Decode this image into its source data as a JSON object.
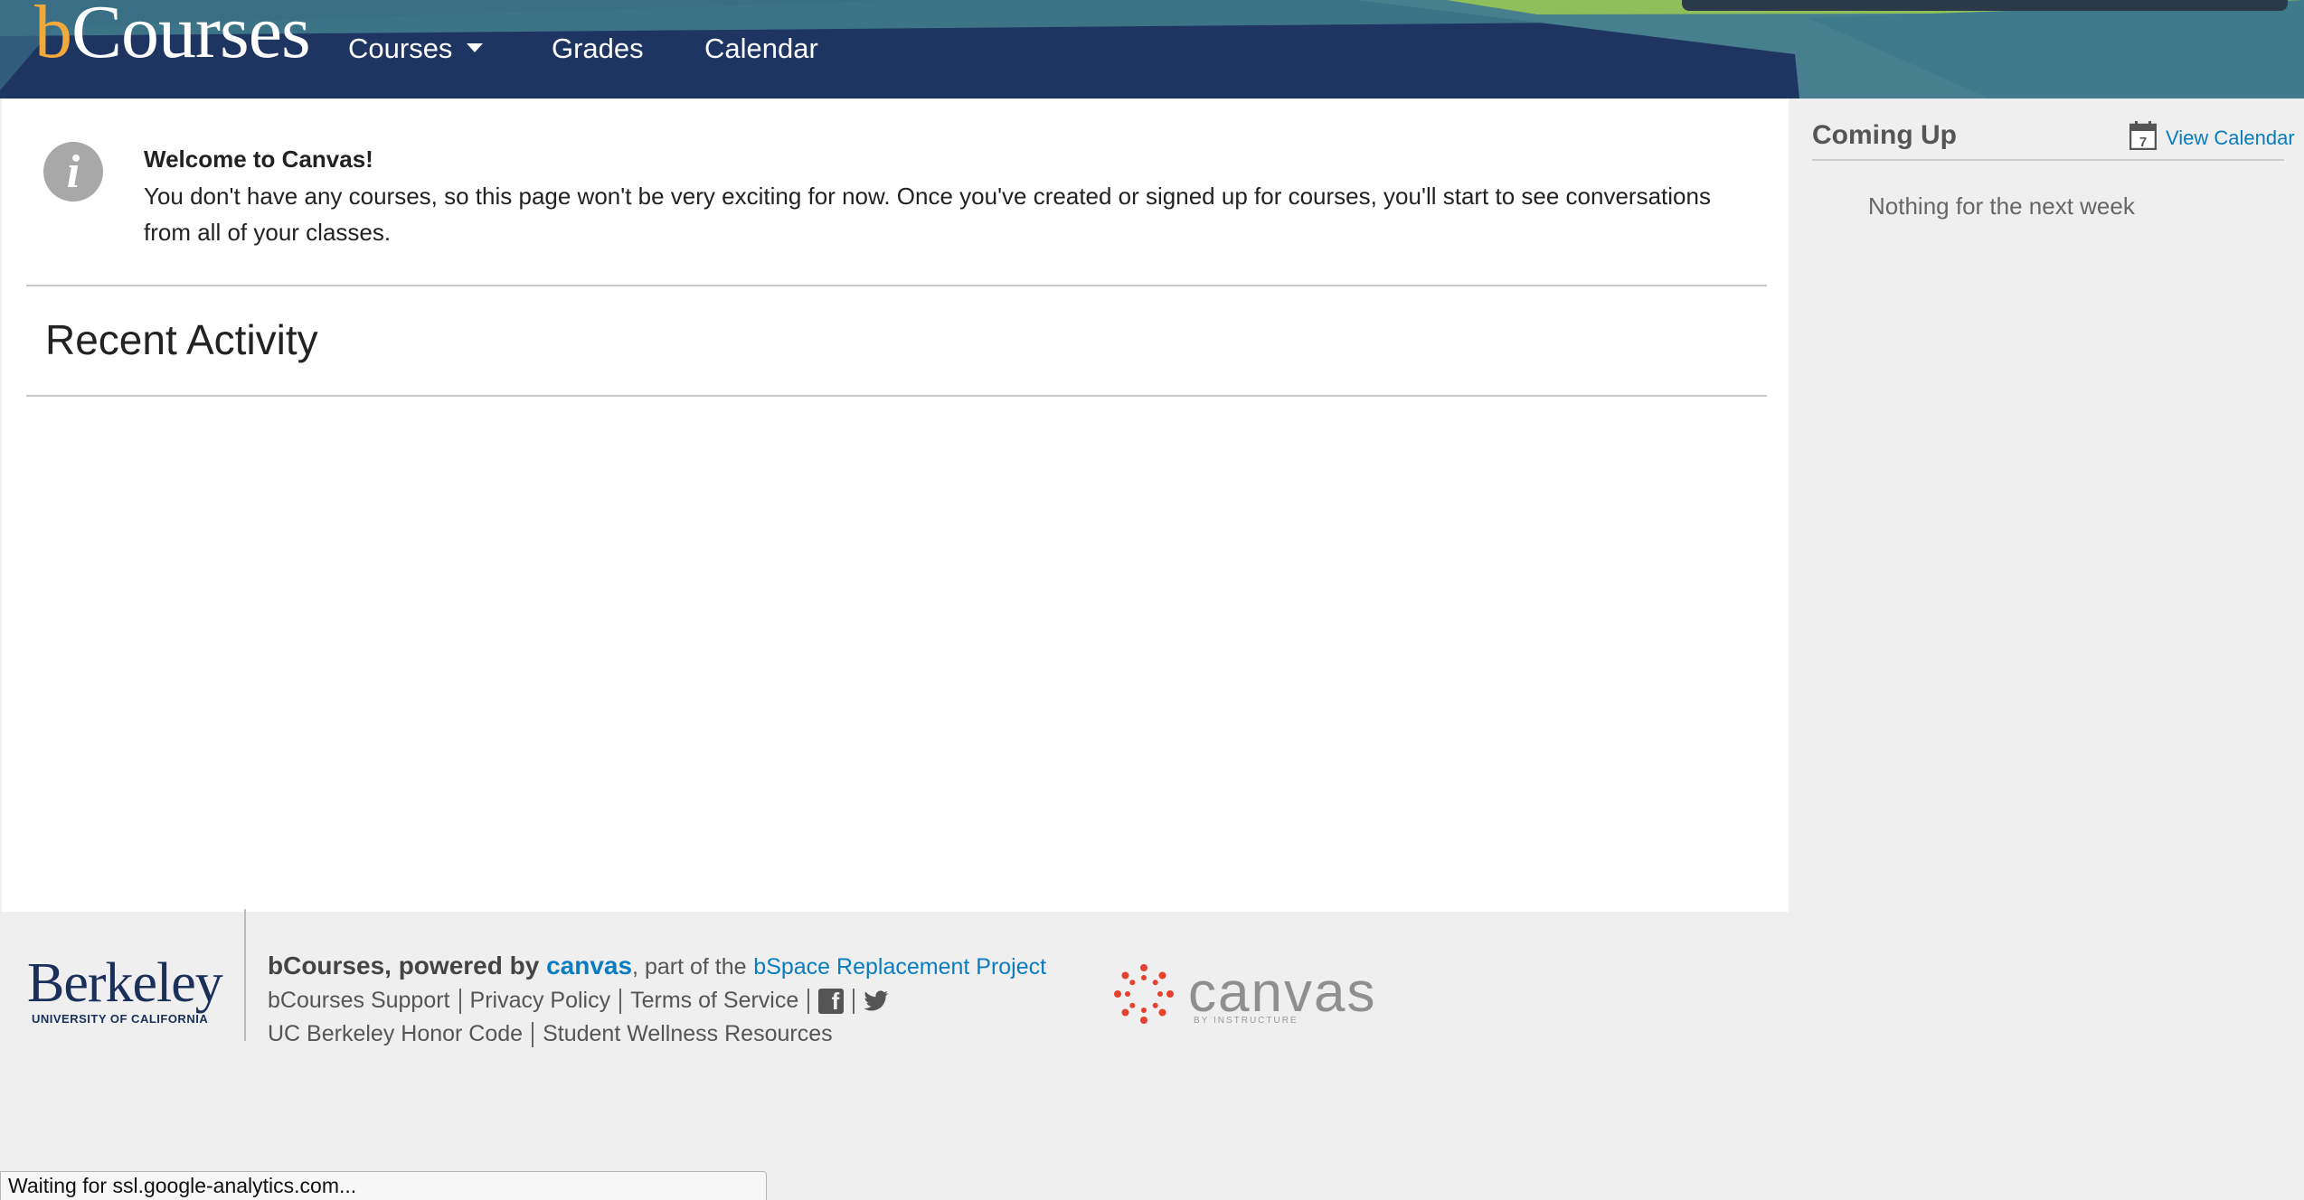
{
  "header": {
    "logo_letter": "b",
    "logo_rest": "Courses",
    "nav": [
      {
        "label": "Courses"
      },
      {
        "label": "Grades"
      },
      {
        "label": "Calendar"
      }
    ],
    "colors": {
      "navy": "#1e3461",
      "teal": "#3f7a8c",
      "green": "#8fbf5a",
      "gold": "#f2a93b"
    }
  },
  "welcome": {
    "title": "Welcome to Canvas!",
    "text": "You don't have any courses, so this page won't be very exciting for now. Once you've created or signed up for courses, you'll start to see conversations from all of your classes.",
    "icon_glyph": "i"
  },
  "recent_activity": {
    "title": "Recent Activity"
  },
  "sidebar": {
    "coming_up": "Coming Up",
    "view_calendar": "View Calendar",
    "calendar_icon_day": "7",
    "empty_text": "Nothing for the next week"
  },
  "footer": {
    "berkeley": "Berkeley",
    "berkeley_sub": "UNIVERSITY OF CALIFORNIA",
    "brand_prefix": "bCourses, powered by",
    "brand_canvas": "canvas",
    "brand_suffix": ", part of the",
    "replacement_link": "bSpace Replacement Project",
    "links_row1": [
      "bCourses Support",
      "Privacy Policy",
      "Terms of Service"
    ],
    "links_row2": [
      "UC Berkeley Honor Code",
      "Student Wellness Resources"
    ],
    "fb_glyph": "f",
    "canvas_logo_text": "canvas",
    "canvas_logo_sub": "BY INSTRUCTURE"
  },
  "status_bar": {
    "text": "Waiting for ssl.google-analytics.com..."
  }
}
